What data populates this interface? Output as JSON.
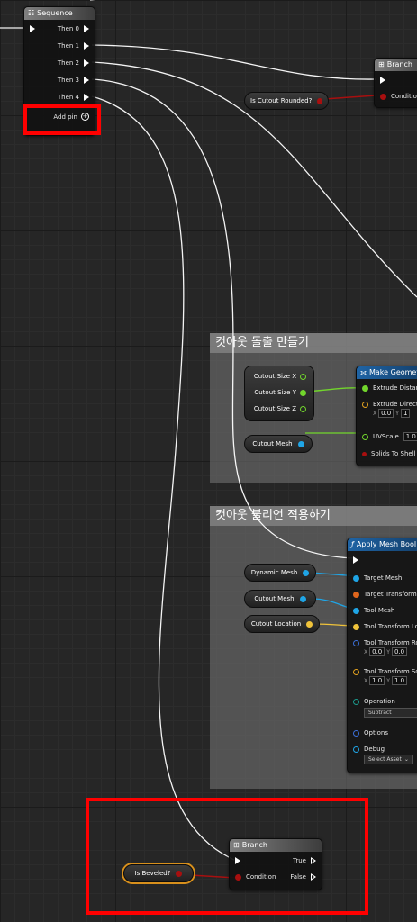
{
  "sequence_node": {
    "title": "Sequence",
    "outputs": [
      "Then 0",
      "Then 1",
      "Then 2",
      "Then 3",
      "Then 4"
    ],
    "add_pin_label": "Add pin"
  },
  "branch_top": {
    "title": "Branch",
    "condition_label": "Condition"
  },
  "is_cutout_rounded": {
    "label": "Is Cutout Rounded?"
  },
  "comment_cutout_extrude": {
    "title": "컷아웃 돌출 만들기"
  },
  "cutout_size_vars": {
    "x": "Cutout Size X",
    "y": "Cutout Size Y",
    "z": "Cutout Size Z"
  },
  "cutout_mesh_var_1": {
    "label": "Cutout Mesh"
  },
  "make_geometry_node": {
    "title": "Make Geometr",
    "extrude_distance": "Extrude Distanc",
    "extrude_direction": "Extrude Directi",
    "x_label": "X",
    "x_value": "0.0",
    "y_label": "Y",
    "y_value": "1",
    "uvscale_label": "UVScale",
    "uvscale_value": "1.0",
    "solids_label": "Solids To Shell"
  },
  "comment_boolean": {
    "title": "컷아웃 불리언 적용하기"
  },
  "dynamic_mesh_var": {
    "label": "Dynamic Mesh"
  },
  "cutout_mesh_var_2": {
    "label": "Cutout Mesh"
  },
  "cutout_location_var": {
    "label": "Cutout Location"
  },
  "apply_mesh_boolean_node": {
    "title": "Apply Mesh Bool",
    "target_mesh": "Target Mesh",
    "target_transform": "Target Transform",
    "tool_mesh": "Tool Mesh",
    "tool_transform_location": "Tool Transform Lo",
    "tool_transform_rotation": "Tool Transform Ro",
    "rot_x_label": "X",
    "rot_x_value": "0.0",
    "rot_y_label": "Y",
    "rot_y_value": "0.0",
    "tool_transform_scale": "Tool Transform Sc",
    "scale_x_label": "X",
    "scale_x_value": "1.0",
    "scale_y_label": "Y",
    "scale_y_value": "1.0",
    "operation_label": "Operation",
    "operation_value": "Subtract",
    "options_label": "Options",
    "debug_label": "Debug",
    "debug_value": "Select Asset"
  },
  "branch_bottom": {
    "title": "Branch",
    "condition_label": "Condition",
    "true_label": "True",
    "false_label": "False"
  },
  "is_beveled": {
    "label": "Is Beveled?"
  },
  "colors": {
    "highlight": "#ff0000",
    "exec_wire": "#ffffff",
    "bool_wire": "#a80f0f",
    "float_wire": "#72d62c",
    "object_wire": "#1fa5e6",
    "vector_wire": "#f0c33a",
    "comment_bg": "#787878",
    "function_header": "#1f64a5"
  },
  "icons": {
    "sequence": "sequence-icon",
    "branch": "branch-icon",
    "make_geometry": "function-icon",
    "apply_mesh_boolean": "function-f-icon",
    "add_pin": "plus-circle-icon"
  }
}
